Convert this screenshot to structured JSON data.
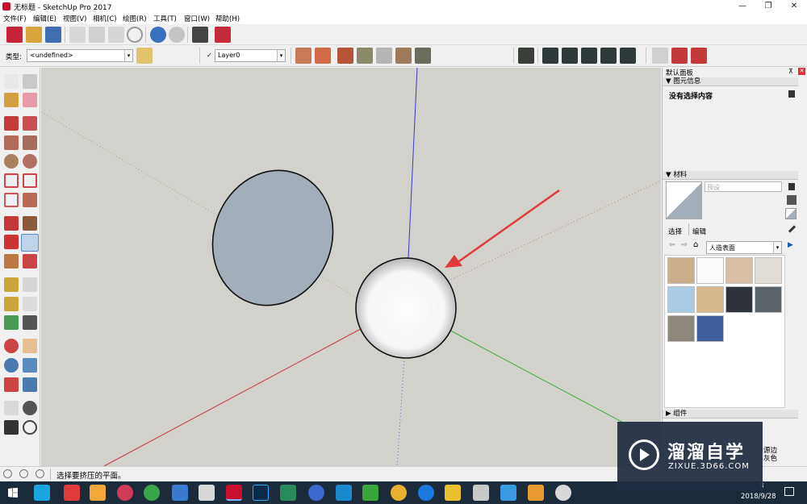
{
  "window": {
    "title": "无标题 - SketchUp Pro 2017"
  },
  "window_controls": {
    "minimize": "—",
    "maximize": "❐",
    "close": "✕"
  },
  "menu": [
    "文件(F)",
    "编辑(E)",
    "视图(V)",
    "相机(C)",
    "绘图(R)",
    "工具(T)",
    "窗口(W)",
    "帮助(H)"
  ],
  "toolbar2": {
    "type_label": "类型:",
    "type_value": "<undefined>",
    "layer_check": "✓",
    "layer_value": "Layer0"
  },
  "right_panel": {
    "default_tray": "默认面板",
    "entity_info": {
      "title": "图元信息",
      "content": "没有选择内容"
    },
    "materials": {
      "title": "材料",
      "name_placeholder": "预设",
      "tab_select": "选择",
      "tab_edit": "编辑",
      "library": "人造表面",
      "swatch_colors": [
        "#c9b08a",
        "#fbfbfb",
        "#d9bfa6",
        "#e1dcd5",
        "#a9cbe3",
        "#d6b88c",
        "#2f333b",
        "#5b646a",
        "#8c877a",
        "#3d5f9c"
      ]
    },
    "components": {
      "title": "组件"
    },
    "partial_labels": [
      "源边",
      "灰色"
    ]
  },
  "status": {
    "message": "选择要挤压的平面。"
  },
  "taskbar": {
    "clock_line1": "8",
    "clock_line2": "2018/9/28"
  },
  "watermark": {
    "brand": "溜溜自学",
    "url": "ZIXUE.3D66.COM"
  }
}
